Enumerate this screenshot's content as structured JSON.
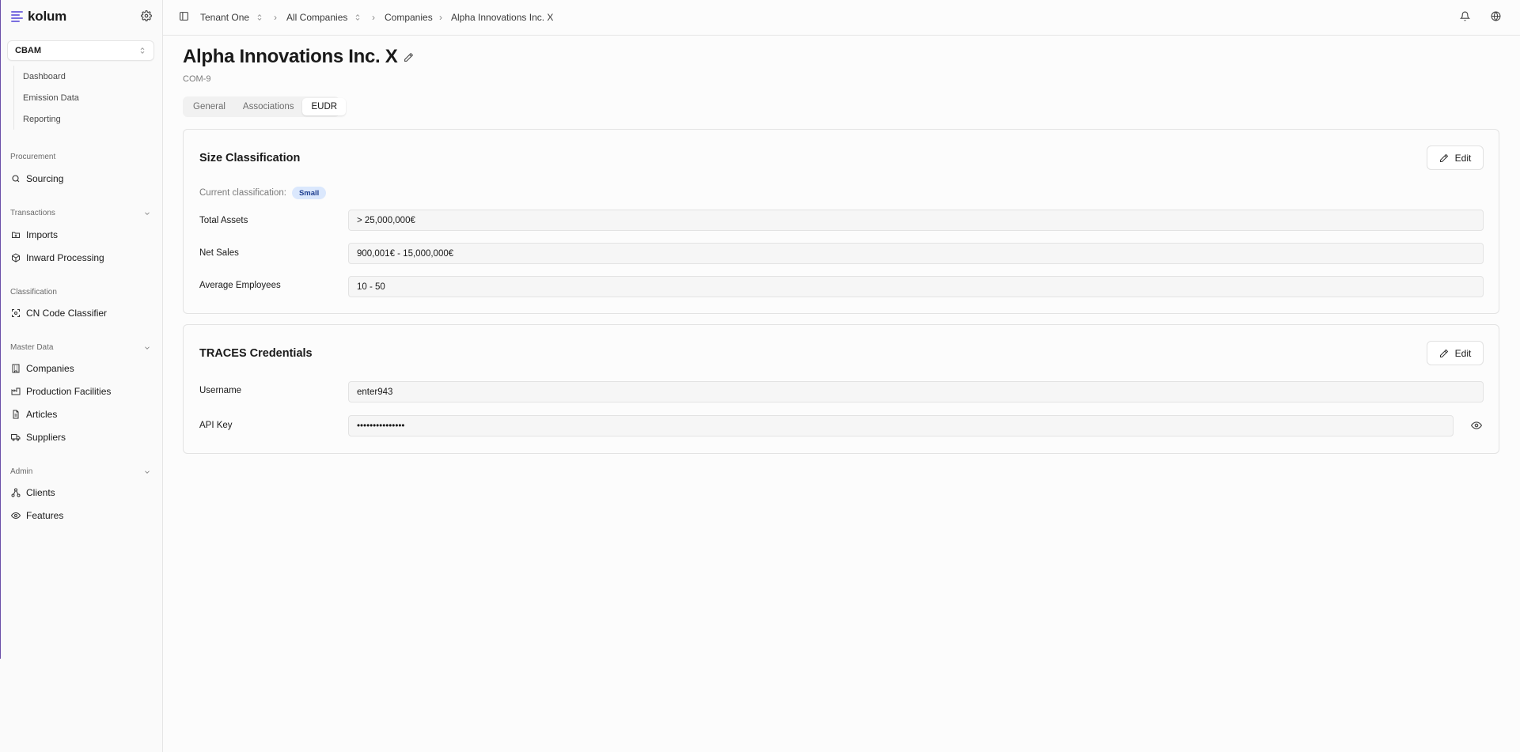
{
  "brand": {
    "name": "kolum",
    "accent": "#7b6fe0"
  },
  "sidebar": {
    "module": "CBAM",
    "module_items": [
      "Dashboard",
      "Emission Data",
      "Reporting"
    ],
    "sections": [
      {
        "label": "Procurement",
        "items": [
          "Sourcing"
        ]
      },
      {
        "label": "Transactions",
        "items": [
          "Imports",
          "Inward Processing"
        ]
      },
      {
        "label": "Classification",
        "items": [
          "CN Code Classifier"
        ]
      },
      {
        "label": "Master Data",
        "items": [
          "Companies",
          "Production Facilities",
          "Articles",
          "Suppliers"
        ]
      },
      {
        "label": "Admin",
        "items": [
          "Clients",
          "Features"
        ]
      }
    ]
  },
  "breadcrumb": [
    "Tenant One",
    "All Companies",
    "Companies",
    "Alpha Innovations Inc. X"
  ],
  "page": {
    "title": "Alpha Innovations Inc. X",
    "code": "COM-9",
    "tabs": [
      "General",
      "Associations",
      "EUDR"
    ],
    "active_tab": "EUDR"
  },
  "size_classification": {
    "title": "Size Classification",
    "edit_label": "Edit",
    "current_label": "Current classification:",
    "current_value": "Small",
    "fields": [
      {
        "label": "Total Assets",
        "value": "> 25,000,000€"
      },
      {
        "label": "Net Sales",
        "value": "900,001€ - 15,000,000€"
      },
      {
        "label": "Average Employees",
        "value": "10 - 50"
      }
    ]
  },
  "traces": {
    "title": "TRACES Credentials",
    "edit_label": "Edit",
    "fields": [
      {
        "label": "Username",
        "value": "enter943"
      },
      {
        "label": "API Key",
        "value": "•••••••••••••••"
      }
    ]
  }
}
